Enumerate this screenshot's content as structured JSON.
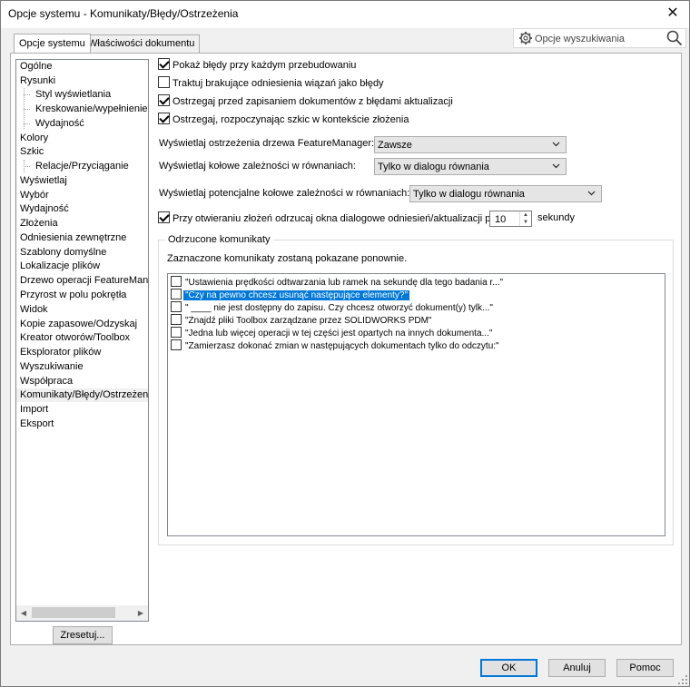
{
  "window": {
    "title": "Opcje systemu - Komunikaty/Błędy/Ostrzeżenia",
    "close_glyph": "✕"
  },
  "tabs": [
    {
      "label": "Opcje systemu",
      "active": true
    },
    {
      "label": "Właściwości dokumentu",
      "active": false
    }
  ],
  "search": {
    "placeholder": "Opcje wyszukiwania",
    "icon": "search-icon",
    "settings_icon": "gear-icon"
  },
  "tree": {
    "items": [
      {
        "label": "Ogólne",
        "level": 0
      },
      {
        "label": "Rysunki",
        "level": 0
      },
      {
        "label": "Styl wyświetlania",
        "level": 1
      },
      {
        "label": "Kreskowanie/wypełnienie obszaru",
        "level": 1
      },
      {
        "label": "Wydajność",
        "level": 1
      },
      {
        "label": "Kolory",
        "level": 0
      },
      {
        "label": "Szkic",
        "level": 0
      },
      {
        "label": "Relacje/Przyciąganie",
        "level": 1
      },
      {
        "label": "Wyświetlaj",
        "level": 0
      },
      {
        "label": "Wybór",
        "level": 0
      },
      {
        "label": "Wydajność",
        "level": 0
      },
      {
        "label": "Złożenia",
        "level": 0
      },
      {
        "label": "Odniesienia zewnętrzne",
        "level": 0
      },
      {
        "label": "Szablony domyślne",
        "level": 0
      },
      {
        "label": "Lokalizacje plików",
        "level": 0
      },
      {
        "label": "Drzewo operacji FeatureManager",
        "level": 0
      },
      {
        "label": "Przyrost w polu pokrętła",
        "level": 0
      },
      {
        "label": "Widok",
        "level": 0
      },
      {
        "label": "Kopie zapasowe/Odzyskaj",
        "level": 0
      },
      {
        "label": "Kreator otworów/Toolbox",
        "level": 0
      },
      {
        "label": "Eksplorator plików",
        "level": 0
      },
      {
        "label": "Wyszukiwanie",
        "level": 0
      },
      {
        "label": "Współpraca",
        "level": 0
      },
      {
        "label": "Komunikaty/Błędy/Ostrzeżenia",
        "level": 0,
        "selected": true
      },
      {
        "label": "Import",
        "level": 0
      },
      {
        "label": "Eksport",
        "level": 0
      }
    ],
    "reset_label": "Zresetuj..."
  },
  "options": {
    "checkboxes": [
      {
        "label": "Pokaż błędy przy każdym przebudowaniu",
        "checked": true
      },
      {
        "label": "Traktuj brakujące odniesienia wiązań jako błędy",
        "checked": false
      },
      {
        "label": "Ostrzegaj przed zapisaniem dokumentów z błędami aktualizacji",
        "checked": true
      },
      {
        "label": "Ostrzegaj, rozpoczynając szkic w kontekście złożenia",
        "checked": true
      }
    ],
    "featuremanager_warnings": {
      "label": "Wyświetlaj ostrzeżenia drzewa FeatureManager:",
      "value": "Zawsze"
    },
    "circular_refs": {
      "label": "Wyświetlaj kołowe zależności w równaniach:",
      "value": "Tylko w dialogu równania"
    },
    "potential_circular_refs": {
      "label": "Wyświetlaj potencjalne kołowe zależności w równaniach:",
      "value": "Tylko w dialogu równania"
    },
    "dismiss_dialogs": {
      "label": "Przy otwieraniu złożeń odrzucaj okna dialogowe odniesień/aktualizacji po:",
      "checked": true,
      "value": "10",
      "unit": "sekundy"
    }
  },
  "dismissed": {
    "title": "Odrzucone komunikaty",
    "hint": "Zaznaczone komunikaty zostaną pokazane ponownie.",
    "messages": [
      {
        "text": "\"Ustawienia prędkości odtwarzania lub ramek na sekundę dla tego badania r...\"",
        "checked": false,
        "selected": false
      },
      {
        "text": "\"Czy na pewno chcesz usunąć następujące elementy?\"",
        "checked": false,
        "selected": true
      },
      {
        "text": "\" ____ nie jest dostępny do zapisu.  Czy chcesz otworzyć dokument(y) tylk...\"",
        "checked": false,
        "selected": false
      },
      {
        "text": "\"Znajdź pliki Toolbox zarządzane przez SOLIDWORKS PDM\"",
        "checked": false,
        "selected": false
      },
      {
        "text": "\"Jedna lub więcej operacji w tej części jest opartych na innych dokumenta...\"",
        "checked": false,
        "selected": false
      },
      {
        "text": "\"Zamierzasz dokonać zmian w następujących dokumentach tylko do odczytu:\"",
        "checked": false,
        "selected": false
      }
    ]
  },
  "footer": {
    "ok": "OK",
    "cancel": "Anuluj",
    "help": "Pomoc"
  },
  "colors": {
    "accent": "#0078d7",
    "selection_bg": "#0078d7",
    "window_bg": "#f0f0f0"
  }
}
